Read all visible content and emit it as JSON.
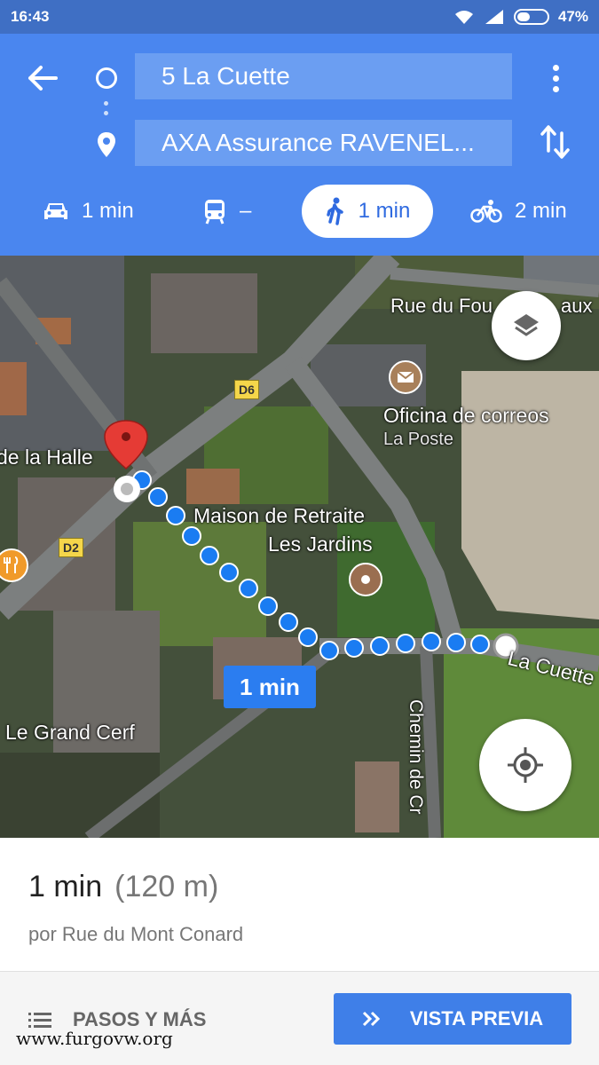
{
  "status_bar": {
    "time": "16:43",
    "battery": "47%"
  },
  "header": {
    "origin": "5 La Cuette",
    "destination": "AXA Assurance RAVENEL..."
  },
  "modes": [
    {
      "icon": "car-icon",
      "label": "1 min"
    },
    {
      "icon": "transit-icon",
      "label": "–"
    },
    {
      "icon": "walk-icon",
      "label": "1 min",
      "selected": true
    },
    {
      "icon": "bike-icon",
      "label": "2 min"
    }
  ],
  "map": {
    "labels": {
      "rue": "Rue du Fou",
      "rue_end": "aux",
      "halle": "de la Halle",
      "correos": "Oficina de correos",
      "la_poste": "La Poste",
      "maison1": "Maison de Retraite",
      "maison2": "Les Jardins",
      "cuette": "La Cuette",
      "grand_cerf": "Le Grand Cerf",
      "chemin": "Chemin de Cr",
      "d6": "D6",
      "d2": "D2"
    },
    "route_chip": "1 min",
    "accent": "#2b7df0"
  },
  "summary": {
    "time": "1 min",
    "distance": "(120 m)",
    "route": "por Rue du Mont Conard"
  },
  "actions": {
    "steps": "PASOS Y MÁS",
    "preview": "VISTA PREVIA"
  },
  "watermark": "www.furgovw.org"
}
